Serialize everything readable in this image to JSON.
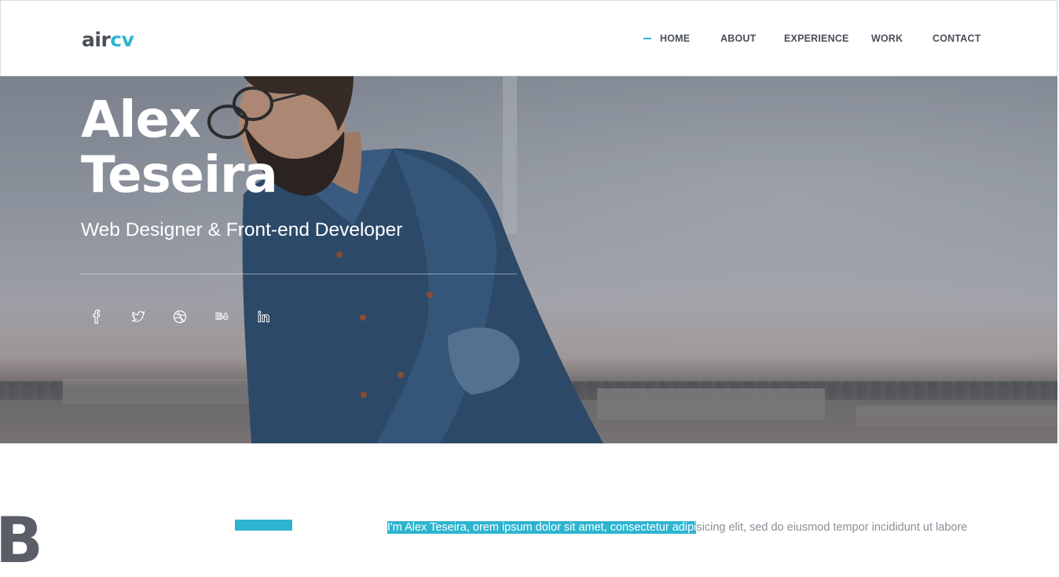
{
  "logo": {
    "part1": "air",
    "part2": "cv"
  },
  "nav": {
    "items": [
      {
        "label": "HOME",
        "active": true
      },
      {
        "label": "ABOUT",
        "active": false
      },
      {
        "label": "EXPERIENCE",
        "active": false
      },
      {
        "label": "WORK",
        "active": false
      },
      {
        "label": "CONTACT",
        "active": false
      }
    ]
  },
  "hero": {
    "first_name": "Alex",
    "last_name": "Teseira",
    "subtitle": "Web Designer & Front-end Developer",
    "social": [
      "facebook-icon",
      "twitter-icon",
      "dribbble-icon",
      "behance-icon",
      "linkedin-icon"
    ]
  },
  "about": {
    "big_letter": "B",
    "intro_highlight": "I'm Alex Teseira, orem ipsum dolor sit amet, consectetur adipi",
    "intro_rest": "sicing elit, sed do eiusmod tempor incididunt ut labore"
  },
  "colors": {
    "accent": "#2db4cf",
    "text_dark": "#4a4f5a",
    "text_muted": "#8a8f98"
  }
}
